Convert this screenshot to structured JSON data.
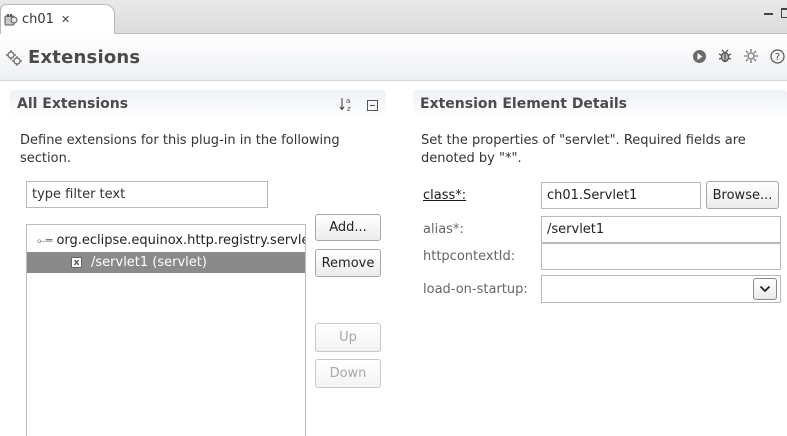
{
  "editor_tab": {
    "title": "ch01",
    "close_glyph": "✕"
  },
  "form_header": {
    "title": "Extensions",
    "tools": [
      "run-icon",
      "debug-icon",
      "export-wizard-icon",
      "help-icon"
    ]
  },
  "all_extensions": {
    "heading": "All Extensions",
    "sort_glyph": "↓ᵃz",
    "description": "Define extensions for this plug-in in the following section.",
    "filter_placeholder": "type filter text",
    "tree": {
      "root_label": "org.eclipse.equinox.http.registry.servlets",
      "child_label": "/servlet1 (servlet)"
    },
    "buttons": {
      "add": "Add...",
      "remove": "Remove",
      "up": "Up",
      "down": "Down"
    }
  },
  "element_details": {
    "heading": "Extension Element Details",
    "description": "Set the properties of \"servlet\". Required fields are denoted by \"*\".",
    "fields": {
      "class_label": "class*:",
      "class_value": "ch01.Servlet1",
      "browse_label": "Browse...",
      "alias_label": "alias*:",
      "alias_value": "/servlet1",
      "httpcontext_label": "httpcontextId:",
      "httpcontext_value": "",
      "load_label": "load-on-startup:",
      "load_value": ""
    }
  },
  "colors": {
    "selection": "#8a8a8a",
    "section_header": "#eef1f6"
  }
}
